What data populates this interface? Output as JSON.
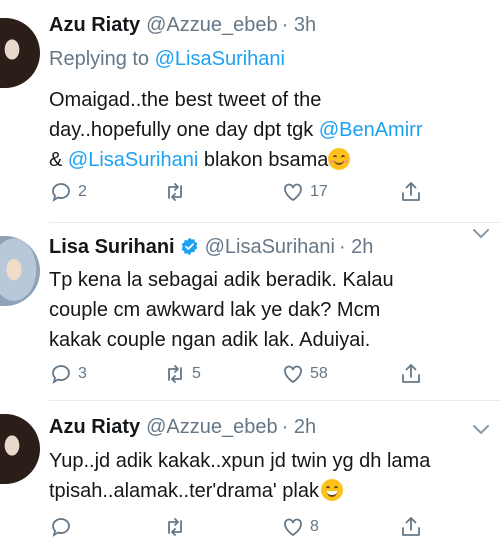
{
  "tweets": [
    {
      "name": "Azu Riaty",
      "handle": "@Azzue_ebeb",
      "time": "· 3h",
      "replying_label": "Replying to",
      "replying_to": "@LisaSurihani",
      "text": {
        "l1": "Omaigad..the best tweet of the",
        "l2a": "day..hopefully one day dpt tgk ",
        "l2_mention": "@BenAmirr",
        "l3a": "& ",
        "l3_mention": "@LisaSurihani",
        "l3b": " blakon bsama"
      },
      "reply_count": "2",
      "retweet_count": "",
      "like_count": "17"
    },
    {
      "name": "Lisa Surihani",
      "handle": "@LisaSurihani",
      "time": "· 2h",
      "text": {
        "l1": "Tp kena la sebagai adik beradik. Kalau",
        "l2": "couple cm awkward lak ye dak? Mcm",
        "l3": "kakak couple ngan adik lak. Aduiyai."
      },
      "reply_count": "3",
      "retweet_count": "5",
      "like_count": "58"
    },
    {
      "name": "Azu Riaty",
      "handle": "@Azzue_ebeb",
      "time": "· 2h",
      "text": {
        "l1": "Yup..jd adik kakak..xpun jd twin yg dh lama",
        "l2": "tpisah..alamak..ter'drama' plak"
      },
      "reply_count": "",
      "retweet_count": "",
      "like_count": "8"
    }
  ],
  "colors": {
    "accent": "#1da1f2",
    "muted": "#657786",
    "text": "#14171a"
  },
  "icons": [
    "reply-icon",
    "retweet-icon",
    "like-icon",
    "share-icon",
    "verified-icon",
    "chevron-down-icon"
  ]
}
